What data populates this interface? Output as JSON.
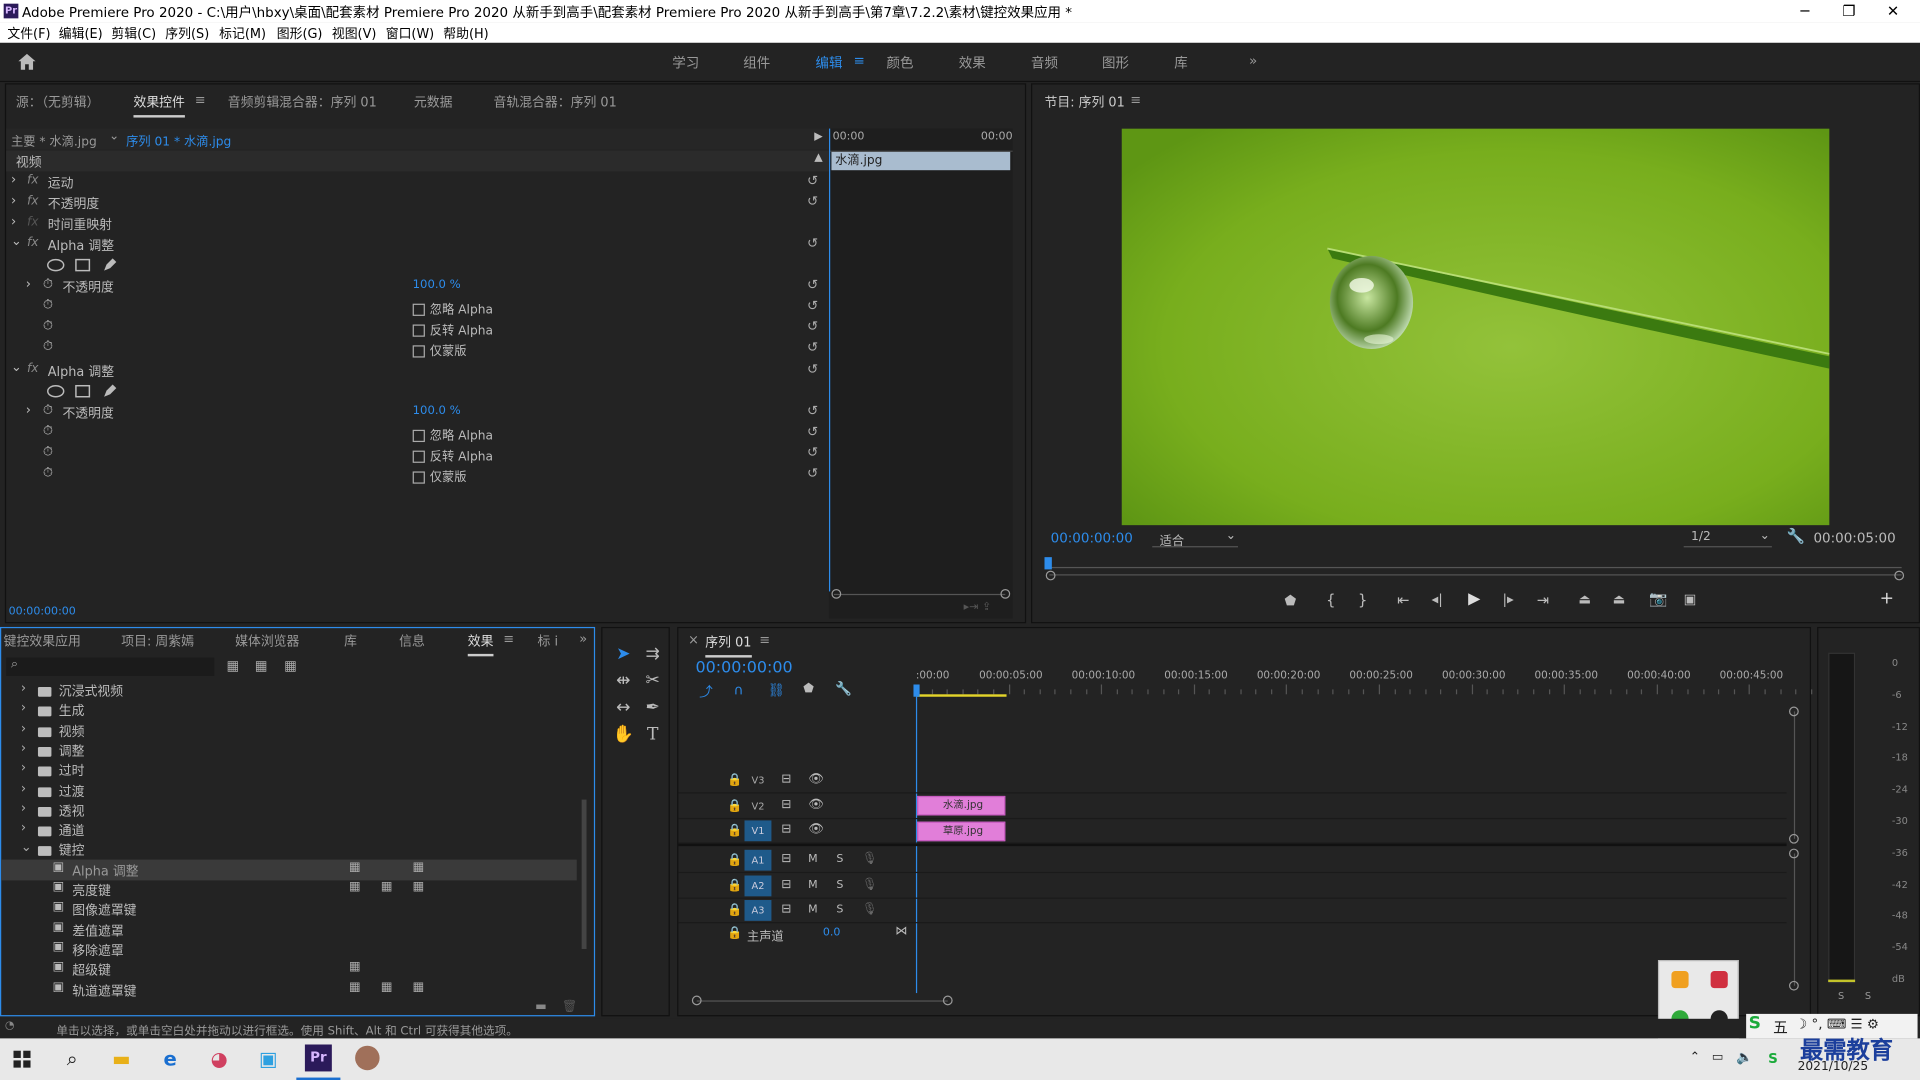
{
  "window": {
    "title": "Adobe Premiere Pro 2020 - C:\\用户\\hbxy\\桌面\\配套素材 Premiere Pro 2020 从新手到高手\\配套素材 Premiere Pro 2020 从新手到高手\\第7章\\7.2.2\\素材\\键控效果应用 *",
    "logo": "Pr",
    "min": "─",
    "max": "❐",
    "close": "✕"
  },
  "menu": [
    "文件(F)",
    "编辑(E)",
    "剪辑(C)",
    "序列(S)",
    "标记(M)",
    "图形(G)",
    "视图(V)",
    "窗口(W)",
    "帮助(H)"
  ],
  "workspaces": [
    "学习",
    "组件",
    "编辑",
    "颜色",
    "效果",
    "音频",
    "图形",
    "库"
  ],
  "workspace_more": "»",
  "source_panel": {
    "tabs": [
      "源：（无剪辑）",
      "效果控件",
      "音频剪辑混合器：序列 01",
      "元数据",
      "音轨混合器：序列 01"
    ],
    "menu_icon": "≡",
    "master": "主要 * 水滴.jpg",
    "sequence": "序列 01 * 水滴.jpg",
    "time_start": "00:00",
    "time_end": "00:00",
    "clip_name": "水滴.jpg",
    "section_video": "视频",
    "fx_rows": [
      {
        "label": "运动"
      },
      {
        "label": "不透明度"
      },
      {
        "label": "时间重映射"
      },
      {
        "label": "Alpha 调整"
      }
    ],
    "alpha2_label": "Alpha 调整",
    "opacity_label": "不透明度",
    "opacity_value": "100.0 %",
    "check_labels": [
      "忽略 Alpha",
      "反转 Alpha",
      "仅蒙版"
    ],
    "timecode": "00:00:00:00"
  },
  "program": {
    "title": "节目: 序列 01",
    "menu_icon": "≡",
    "timecode": "00:00:00:00",
    "fit": "适合",
    "resolution": "1/2",
    "duration": "00:00:05:00",
    "add": "+"
  },
  "project": {
    "tabs": [
      "键控效果应用",
      "项目: 周紫嫣",
      "媒体浏览器",
      "库",
      "信息",
      "效果",
      "标 i"
    ],
    "more": "»",
    "search_placeholder": "",
    "folders": [
      "沉浸式视频",
      "生成",
      "视频",
      "调整",
      "过时",
      "过渡",
      "透视",
      "通道",
      "键控"
    ],
    "effects": [
      "Alpha 调整",
      "亮度键",
      "图像遮罩键",
      "差值遮罩",
      "移除遮罩",
      "超级键",
      "轨道遮罩键"
    ]
  },
  "timeline": {
    "title": "序列 01",
    "menu_icon": "≡",
    "timecode": "00:00:00:00",
    "ruler": [
      ":00:00",
      "00:00:05:00",
      "00:00:10:00",
      "00:00:15:00",
      "00:00:20:00",
      "00:00:25:00",
      "00:00:30:00",
      "00:00:35:00",
      "00:00:40:00",
      "00:00:45:00"
    ],
    "video_tracks": [
      "V3",
      "V2",
      "V1"
    ],
    "audio_tracks": [
      "A1",
      "A2",
      "A3"
    ],
    "m": "M",
    "s": "S",
    "master_label": "主声道",
    "master_value": "0.0",
    "clips": [
      {
        "name": "水滴.jpg",
        "track": "V2"
      },
      {
        "name": "草原.jpg",
        "track": "V1"
      }
    ]
  },
  "meters": {
    "scale": [
      "0",
      "-6",
      "-12",
      "-18",
      "-24",
      "-30",
      "-36",
      "-42",
      "-48",
      "-54",
      "dB"
    ],
    "solo": [
      "S",
      "S"
    ]
  },
  "status": {
    "text": "单击以选择，或单击空白处并拖动以进行框选。使用 Shift、Alt 和 Ctrl 可获得其他选项。"
  },
  "taskbar": {
    "date": "2021/10/25",
    "watermark": "最需教育",
    "ime": "五"
  }
}
